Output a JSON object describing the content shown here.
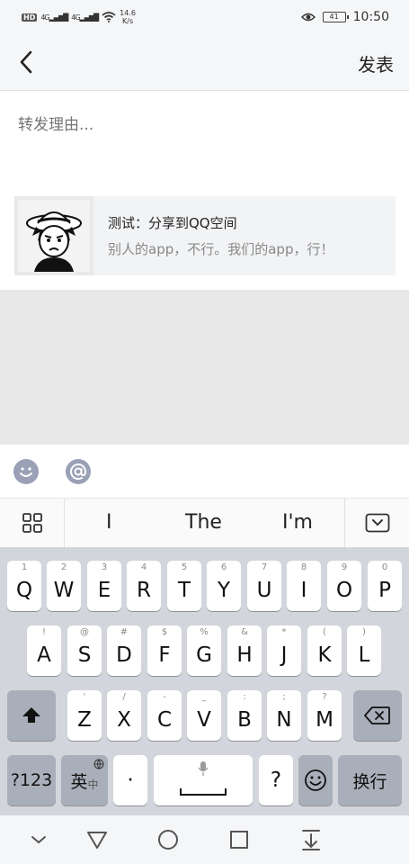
{
  "status": {
    "hd": "HD",
    "sim1": "4G",
    "sim2": "4G",
    "speed_value": "14.6",
    "speed_unit": "K/s",
    "battery": "41",
    "time": "10:50"
  },
  "header": {
    "publish_label": "发表"
  },
  "compose": {
    "placeholder": "转发理由..."
  },
  "share_card": {
    "title": "测试：分享到QQ空间",
    "description": "别人的app，不行。我们的app，行！"
  },
  "suggestions": [
    "I",
    "The",
    "I'm"
  ],
  "keyboard": {
    "row1": [
      {
        "hint": "1",
        "label": "Q"
      },
      {
        "hint": "2",
        "label": "W"
      },
      {
        "hint": "3",
        "label": "E"
      },
      {
        "hint": "4",
        "label": "R"
      },
      {
        "hint": "5",
        "label": "T"
      },
      {
        "hint": "6",
        "label": "Y"
      },
      {
        "hint": "7",
        "label": "U"
      },
      {
        "hint": "8",
        "label": "I"
      },
      {
        "hint": "9",
        "label": "O"
      },
      {
        "hint": "0",
        "label": "P"
      }
    ],
    "row2": [
      {
        "hint": "!",
        "label": "A"
      },
      {
        "hint": "@",
        "label": "S"
      },
      {
        "hint": "#",
        "label": "D"
      },
      {
        "hint": "$",
        "label": "F"
      },
      {
        "hint": "%",
        "label": "G"
      },
      {
        "hint": "&",
        "label": "H"
      },
      {
        "hint": "*",
        "label": "J"
      },
      {
        "hint": "(",
        "label": "K"
      },
      {
        "hint": ")",
        "label": "L"
      }
    ],
    "row3": [
      {
        "hint": "'",
        "label": "Z"
      },
      {
        "hint": "/",
        "label": "X"
      },
      {
        "hint": "-",
        "label": "C"
      },
      {
        "hint": "_",
        "label": "V"
      },
      {
        "hint": ":",
        "label": "B"
      },
      {
        "hint": ";",
        "label": "N"
      },
      {
        "hint": "?",
        "label": "M"
      }
    ],
    "numbers_label": "?123",
    "lang_label": "英",
    "lang_sub": "中",
    "dot_label": "·",
    "question_label": "?",
    "enter_label": "换行"
  },
  "colors": {
    "accent_icon": "#9aa1b6",
    "keyboard_bg": "#d2d5db"
  }
}
